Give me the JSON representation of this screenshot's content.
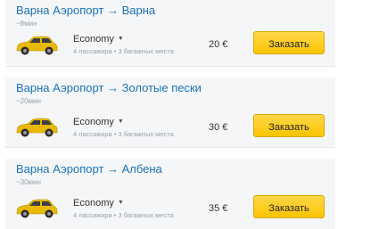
{
  "transfers": [
    {
      "route": "Варна Аэропорт → Варна",
      "duration": "~8мин",
      "car_class": "Economy",
      "capacity": "4 пассажира • 3 багажных места",
      "price": "20 €",
      "order_label": "Заказать"
    },
    {
      "route": "Варна Аэропорт → Золотые пески",
      "duration": "~20мин",
      "car_class": "Economy",
      "capacity": "4 пассажира • 3 багажных места",
      "price": "30 €",
      "order_label": "Заказать"
    },
    {
      "route": "Варна Аэропорт → Албена",
      "duration": "~30мин",
      "car_class": "Economy",
      "capacity": "4 пассажира • 3 багажных места",
      "price": "35 €",
      "order_label": "Заказать"
    }
  ],
  "colors": {
    "route_link": "#1a73b8",
    "button_yellow": "#fbc400",
    "car_yellow": "#e8b900",
    "card_background": "#f5f6f8"
  },
  "icons": {
    "car": "yellow-hatchback-car-icon",
    "dropdown": "caret-down-icon"
  }
}
